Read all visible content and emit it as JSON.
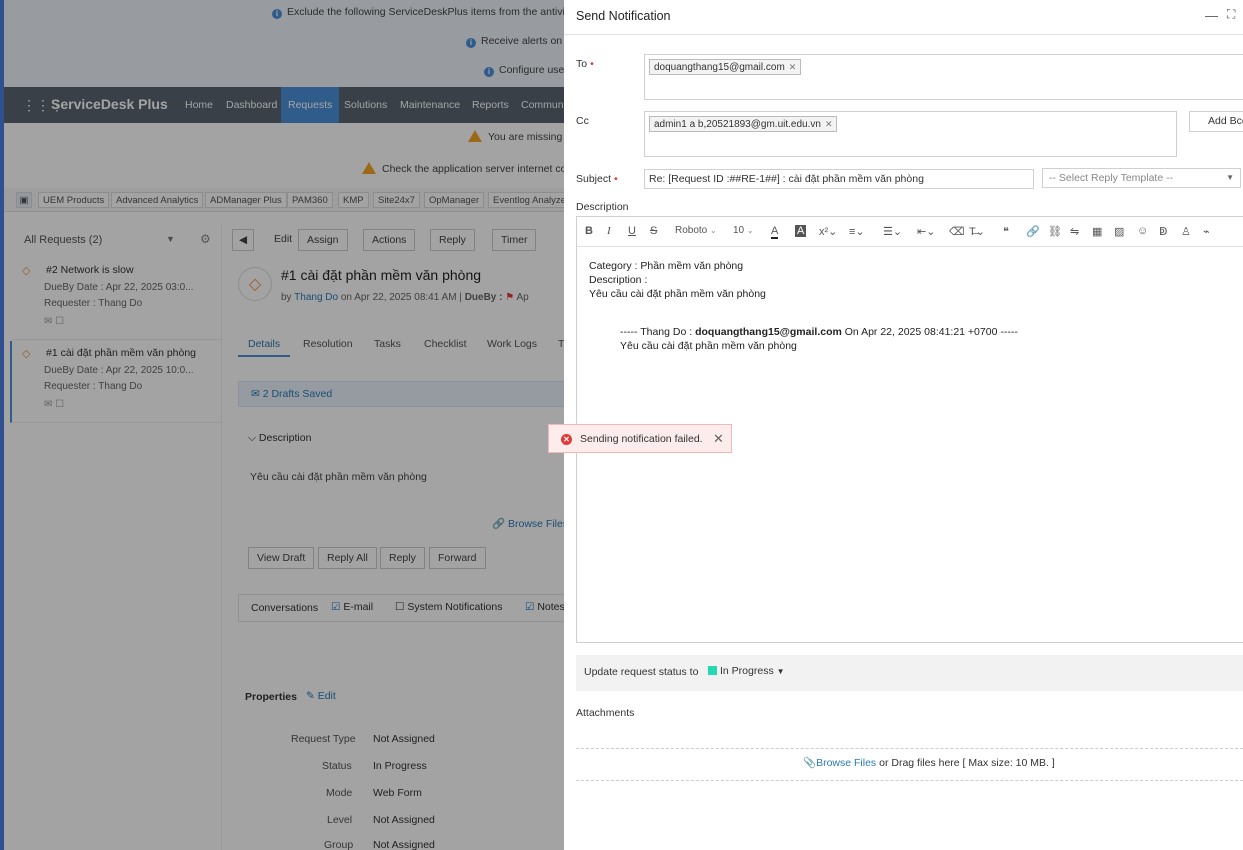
{
  "background": {
    "banner_lines": [
      "Exclude the following ServiceDeskPlus items from the antivirus",
      "Receive alerts on s",
      "Configure use"
    ],
    "logo": "ServiceDesk Plus",
    "nav_tabs": [
      "Home",
      "Dashboard",
      "Requests",
      "Solutions",
      "Maintenance",
      "Reports",
      "Commun"
    ],
    "warnings": [
      "You are missing o",
      "Check the application server internet conn"
    ],
    "products": [
      "UEM Products",
      "Advanced Analytics",
      "ADManager Plus",
      "PAM360",
      "KMP",
      "Site24x7",
      "OpManager",
      "Eventlog Analyzer"
    ],
    "filter_label": "All Requests (2)",
    "requests": [
      {
        "title": "#2 Network is slow",
        "dueby": "DueBy Date : Apr 22, 2025 03:0...",
        "requester": "Requester : Thang Do"
      },
      {
        "title": "#1 cài đặt phần mềm văn phòng",
        "dueby": "DueBy Date : Apr 22, 2025 10:0...",
        "requester": "Requester : Thang Do"
      }
    ],
    "toolbar": {
      "edit": "Edit",
      "assign": "Assign",
      "actions": "Actions",
      "reply": "Reply",
      "timer": "Timer"
    },
    "request_title": "#1  cài đặt phần mềm văn phòng",
    "request_meta": {
      "by": "by",
      "author": "Thang Do",
      "on": "on  Apr 22, 2025 08:41 AM",
      "dueby": "DueBy :",
      "ap": "Ap"
    },
    "detail_tabs": [
      "Details",
      "Resolution",
      "Tasks",
      "Checklist",
      "Work Logs",
      "T"
    ],
    "drafts": "2 Drafts Saved",
    "description_heading": "Description",
    "description_text": "Yêu cầu cài đặt phần mềm văn phòng",
    "browse_files": "Browse Files",
    "action_buttons": [
      "View Draft",
      "Reply All",
      "Reply",
      "Forward"
    ],
    "conversations": {
      "label": "Conversations",
      "email": "E-mail",
      "system": "System Notifications",
      "notes": "Notes"
    },
    "properties": {
      "heading": "Properties",
      "edit": "Edit",
      "rows": [
        {
          "k": "Request Type",
          "v": "Not Assigned"
        },
        {
          "k": "Status",
          "v": "In Progress"
        },
        {
          "k": "Mode",
          "v": "Web Form"
        },
        {
          "k": "Level",
          "v": "Not Assigned"
        },
        {
          "k": "Group",
          "v": "Not Assigned"
        }
      ]
    }
  },
  "panel": {
    "title": "Send Notification",
    "to_label": "To",
    "to_chip": "doquangthang15@gmail.com",
    "cc_label": "Cc",
    "cc_chip": "admin1 a b,20521893@gm.uit.edu.vn",
    "add_bcc": "Add Bcc",
    "subject_label": "Subject",
    "subject_value": "Re: [Request ID :##RE-1##] : cài đặt phần mềm văn phòng",
    "reply_template": "-- Select Reply Template --",
    "description_label": "Description",
    "font_name": "Roboto",
    "font_size": "10",
    "body": {
      "line1": "Category : Phần mềm văn phòng",
      "line2": "Description :",
      "line3": "Yêu cầu cài đặt phần mềm văn phòng",
      "quote_prefix": "----- Thang Do : ",
      "quote_email": "doquangthang15@gmail.com",
      "quote_suffix": " On Apr 22, 2025 08:41:21 +0700 -----",
      "quote_text": "Yêu cầu cài đặt phần mềm văn phòng"
    },
    "status_label": "Update request status to   :",
    "status_value": "In Progress",
    "status_color": "#26d9b0",
    "attachments_label": "Attachments",
    "browse_files": "Browse Files",
    "drop_text": " or Drag files here [ Max size: 10 MB. ]"
  },
  "toast": {
    "message": "Sending notification failed."
  },
  "colors": {
    "accent": "#4a90d9",
    "error": "#e53935",
    "required": "#e53935"
  }
}
